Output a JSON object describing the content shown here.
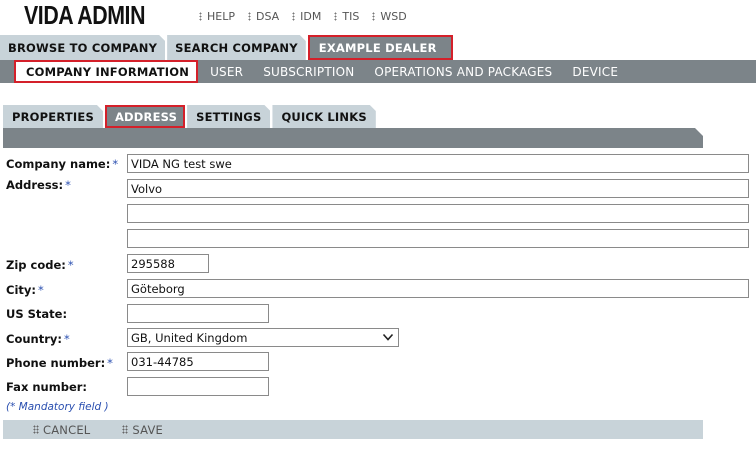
{
  "app": {
    "logo": "VIDA ADMIN"
  },
  "top_links": [
    {
      "label": "HELP",
      "icon": "dots-icon"
    },
    {
      "label": "DSA",
      "icon": "dots-icon"
    },
    {
      "label": "IDM",
      "icon": "dots-icon"
    },
    {
      "label": "TIS",
      "icon": "dots-icon"
    },
    {
      "label": "WSD",
      "icon": "dots-icon"
    }
  ],
  "main_tabs": [
    {
      "label": "BROWSE TO COMPANY",
      "active": false
    },
    {
      "label": "SEARCH COMPANY",
      "active": false
    },
    {
      "label": "EXAMPLE DEALER",
      "active": true
    }
  ],
  "sub_tabs": [
    {
      "label": "COMPANY INFORMATION",
      "active": true
    },
    {
      "label": "USER",
      "active": false
    },
    {
      "label": "SUBSCRIPTION",
      "active": false
    },
    {
      "label": "OPERATIONS AND PACKAGES",
      "active": false
    },
    {
      "label": "DEVICE",
      "active": false
    }
  ],
  "section_tabs": [
    {
      "label": "PROPERTIES",
      "active": false
    },
    {
      "label": "ADDRESS",
      "active": true
    },
    {
      "label": "SETTINGS",
      "active": false
    },
    {
      "label": "QUICK LINKS",
      "active": false
    }
  ],
  "form": {
    "required_marker": "*",
    "company_name": {
      "label": "Company name:",
      "value": "VIDA NG test swe",
      "required": true
    },
    "address": {
      "label": "Address:",
      "line1": "Volvo",
      "line2": "",
      "line3": "",
      "required": true
    },
    "zip": {
      "label": "Zip code:",
      "value": "295588",
      "required": true
    },
    "city": {
      "label": "City:",
      "value": "Göteborg",
      "required": true
    },
    "us_state": {
      "label": "US State:",
      "value": "",
      "required": false
    },
    "country": {
      "label": "Country:",
      "value": "GB, United Kingdom",
      "required": true
    },
    "phone": {
      "label": "Phone number:",
      "value": "031-44785",
      "required": true
    },
    "fax": {
      "label": "Fax number:",
      "value": "",
      "required": false
    },
    "mandatory_note": "(* Mandatory field )"
  },
  "actions": {
    "cancel": "CANCEL",
    "save": "SAVE"
  },
  "colors": {
    "accent_red": "#d4202a",
    "bar_gray": "#7c8489",
    "tab_light": "#c8d3d9",
    "required_blue": "#2a4fb0"
  }
}
